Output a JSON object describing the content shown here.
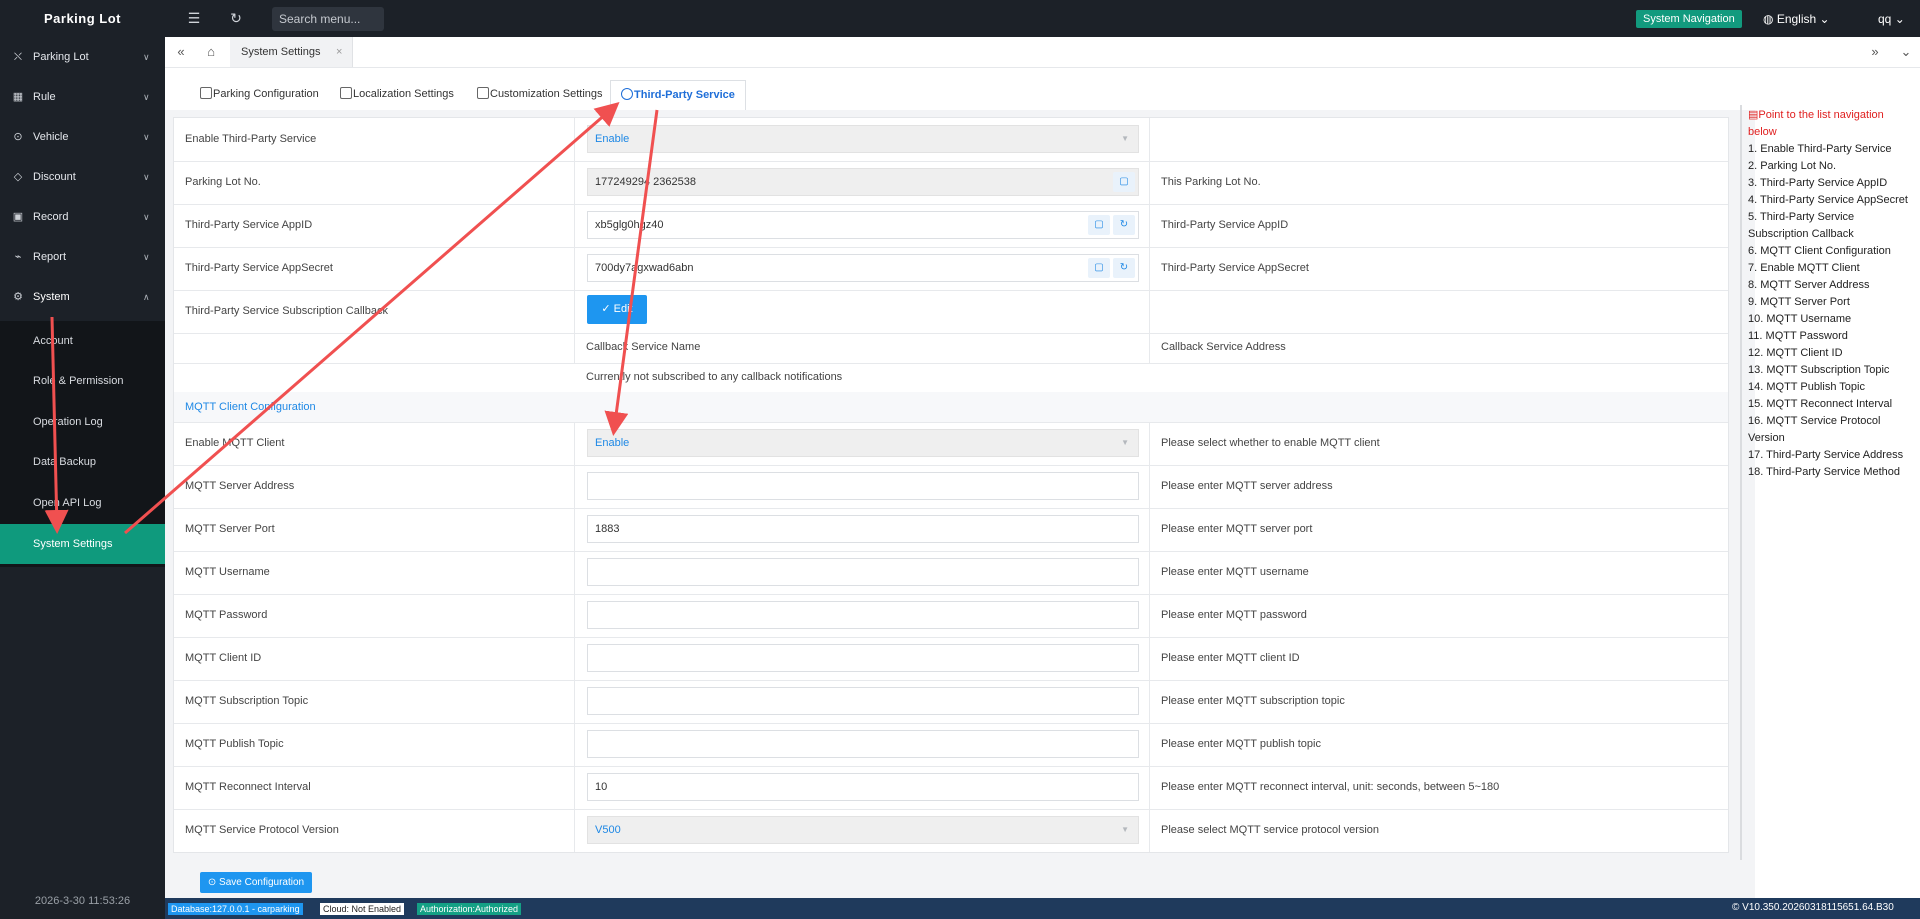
{
  "app": {
    "brand": "Parking Lot",
    "search_placeholder": "Search menu...",
    "system_navigation": "System Navigation",
    "language": "English",
    "user": "qq"
  },
  "sidebar": {
    "items": [
      {
        "label": "Parking Lot",
        "icon": "parking-icon"
      },
      {
        "label": "Rule",
        "icon": "rule-icon"
      },
      {
        "label": "Vehicle",
        "icon": "vehicle-icon"
      },
      {
        "label": "Discount",
        "icon": "discount-icon"
      },
      {
        "label": "Record",
        "icon": "record-icon"
      },
      {
        "label": "Report",
        "icon": "report-icon"
      },
      {
        "label": "System",
        "icon": "gear-icon"
      }
    ],
    "sub_items": [
      {
        "label": "Account"
      },
      {
        "label": "Role & Permission"
      },
      {
        "label": "Operation Log"
      },
      {
        "label": "Data Backup"
      },
      {
        "label": "Open API Log"
      },
      {
        "label": "System Settings"
      }
    ],
    "clock": "2026-3-30 11:53:26"
  },
  "tabstrip": {
    "tab": "System Settings",
    "close": "×"
  },
  "subtabs": [
    {
      "label": "Parking Configuration"
    },
    {
      "label": "Localization Settings"
    },
    {
      "label": "Customization Settings"
    },
    {
      "label": "Third-Party Service"
    }
  ],
  "form": {
    "rows": [
      {
        "label": "Enable Third-Party Service",
        "value": "Enable",
        "hint": ""
      },
      {
        "label": "Parking Lot No.",
        "value": "177249294 2362538",
        "hint": "This Parking Lot No."
      },
      {
        "label": "Third-Party Service AppID",
        "value": "xb5glg0hgz40",
        "hint": "Third-Party Service AppID"
      },
      {
        "label": "Third-Party Service AppSecret",
        "value": "700dy7agxwad6abn",
        "hint": "Third-Party Service AppSecret"
      },
      {
        "label": "Third-Party Service Subscription Callback",
        "value": "",
        "hint": ""
      }
    ],
    "edit_button": "✓ Edit",
    "callback_header_name": "Callback Service Name",
    "callback_header_address": "Callback Service Address",
    "callback_empty": "Currently not subscribed to any callback notifications",
    "mqtt_section": "MQTT Client Configuration",
    "mqtt_rows": [
      {
        "label": "Enable MQTT Client",
        "value": "Enable",
        "hint": "Please select whether to enable MQTT client"
      },
      {
        "label": "MQTT Server Address",
        "value": "",
        "hint": "Please enter MQTT server address"
      },
      {
        "label": "MQTT Server Port",
        "value": "1883",
        "hint": "Please enter MQTT server port"
      },
      {
        "label": "MQTT Username",
        "value": "",
        "hint": "Please enter MQTT username"
      },
      {
        "label": "MQTT Password",
        "value": "",
        "hint": "Please enter MQTT password"
      },
      {
        "label": "MQTT Client ID",
        "value": "",
        "hint": "Please enter MQTT client ID"
      },
      {
        "label": "MQTT Subscription Topic",
        "value": "",
        "hint": "Please enter MQTT subscription topic"
      },
      {
        "label": "MQTT Publish Topic",
        "value": "",
        "hint": "Please enter MQTT publish topic"
      },
      {
        "label": "MQTT Reconnect Interval",
        "value": "10",
        "hint": "Please enter MQTT reconnect interval, unit: seconds, between 5~180"
      },
      {
        "label": "MQTT Service Protocol Version",
        "value": "V500",
        "hint": "Please select MQTT service protocol version"
      }
    ],
    "save_button": "Save Configuration"
  },
  "right_list": {
    "title": "Point to the list navigation below",
    "items": [
      "1. Enable Third-Party Service",
      "2. Parking Lot No.",
      "3. Third-Party Service AppID",
      "4. Third-Party Service AppSecret",
      "5. Third-Party Service Subscription Callback",
      "6. MQTT Client Configuration",
      "7. Enable MQTT Client",
      "8. MQTT Server Address",
      "9. MQTT Server Port",
      "10. MQTT Username",
      "11. MQTT Password",
      "12. MQTT Client ID",
      "13. MQTT Subscription Topic",
      "14. MQTT Publish Topic",
      "15. MQTT Reconnect Interval",
      "16. MQTT Service Protocol Version",
      "17. Third-Party Service Address",
      "18. Third-Party Service Method"
    ]
  },
  "status": {
    "database": "Database:127.0.0.1 - carparking",
    "cloud": "Cloud: Not Enabled",
    "authorization": "Authorization:Authorized",
    "version": "V10.350.20260318115651.64.B30"
  },
  "colors": {
    "accent": "#0f9a7d",
    "primary": "#1e96f0",
    "annotation": "#f05050"
  }
}
